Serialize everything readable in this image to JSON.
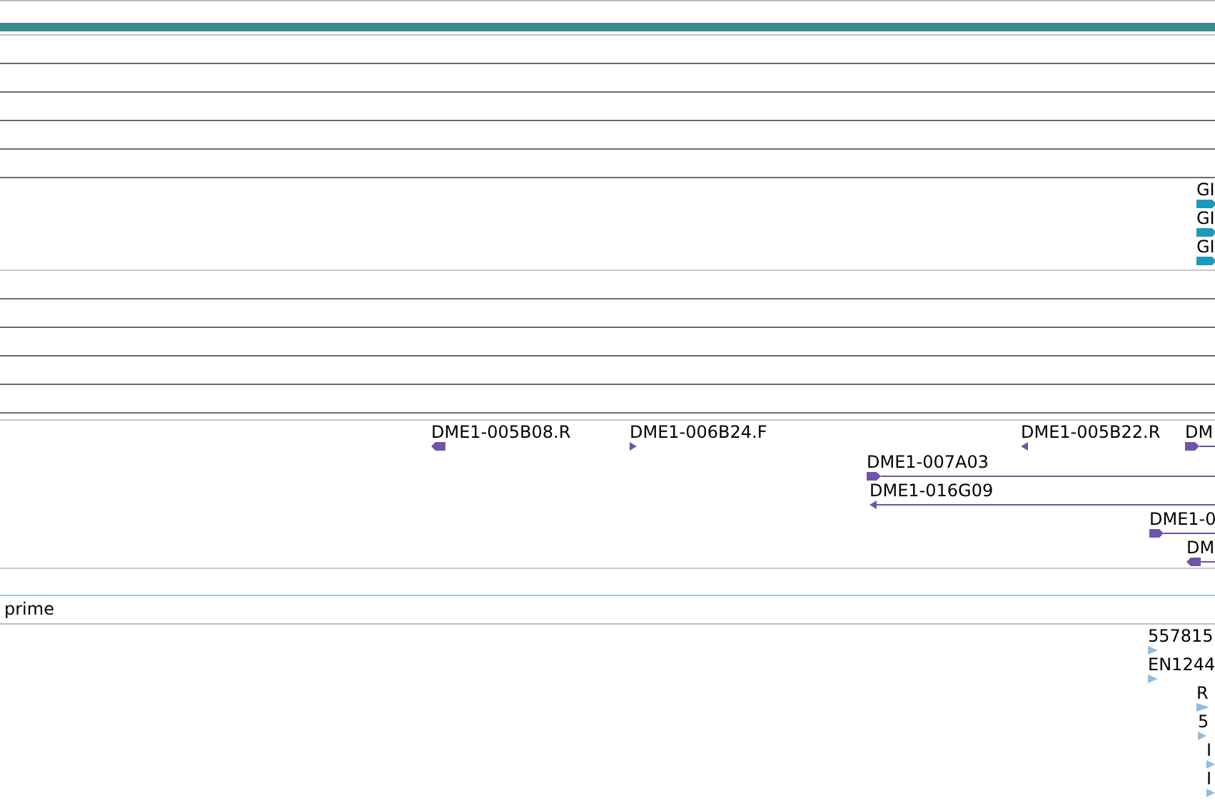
{
  "gene_track": {
    "features": [
      {
        "label": "GI",
        "reverse": false
      },
      {
        "label": "GI",
        "reverse": false
      },
      {
        "label": "GI",
        "reverse": false
      }
    ]
  },
  "clone_track": {
    "features": [
      {
        "label": "DME1-005B08.R",
        "reverse": true
      },
      {
        "label": "DME1-006B24.F",
        "reverse": false
      },
      {
        "label": "DME1-005B22.R",
        "reverse": true
      },
      {
        "label": "DM",
        "reverse": false
      },
      {
        "label": "DME1-007A03",
        "reverse": false
      },
      {
        "label": "DME1-016G09",
        "reverse": true
      },
      {
        "label": "DME1-0",
        "reverse": false
      },
      {
        "label": "DM",
        "reverse": true
      }
    ]
  },
  "prime_track": {
    "label": "prime"
  },
  "est_track": {
    "features": [
      {
        "label": "557815",
        "reverse": false
      },
      {
        "label": "EN1244",
        "reverse": false
      },
      {
        "label": "R",
        "reverse": false
      },
      {
        "label": "5",
        "reverse": false
      },
      {
        "label": "I",
        "reverse": false
      },
      {
        "label": "I",
        "reverse": false
      }
    ]
  }
}
